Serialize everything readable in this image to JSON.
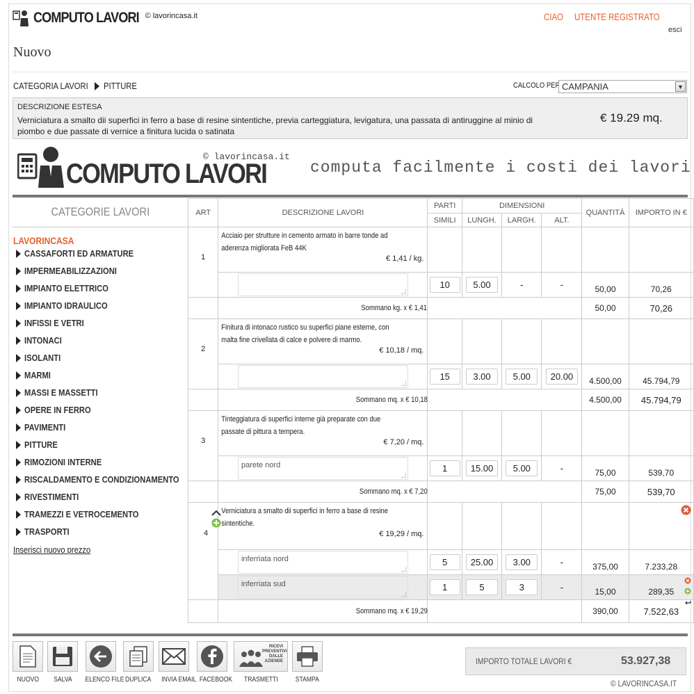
{
  "header": {
    "brand": "COMPUTO LAVORI",
    "site": "© lavorincasa.it",
    "greeting": "CIAO",
    "user": "UTENTE REGISTRATO",
    "logout": "esci"
  },
  "page_title": "Nuovo",
  "breadcrumb": {
    "root": "CATEGORIA LAVORI",
    "current": "PITTURE"
  },
  "calc": {
    "label": "CALCOLO PER",
    "region": "CAMPANIA"
  },
  "description": {
    "heading": "DESCRIZIONE ESTESA",
    "text": "Verniciatura a smalto dii superfici in ferro a base di resine sintentiche, previa carteggiatura, levigatura, una passata di antiruggine al minio di piombo e due passate di vernice a finitura lucida o satinata",
    "price": "€ 19.29 mq."
  },
  "banner": {
    "brand": "COMPUTO LAVORI",
    "site": "© lavorincasa.it",
    "tagline": "computa facilmente i costi dei lavori"
  },
  "sidebar": {
    "title": "CATEGORIE LAVORI",
    "root": "LAVORINCASA",
    "items": [
      "CASSAFORTI ED ARMATURE",
      "IMPERMEABILIZZAZIONI",
      "IMPIANTO ELETTRICO",
      "IMPIANTO IDRAULICO",
      "INFISSI E VETRI",
      "INTONACI",
      "ISOLANTI",
      "MARMI",
      "MASSI E MASSETTI",
      "OPERE IN FERRO",
      "PAVIMENTI",
      "PITTURE",
      "RIMOZIONI INTERNE",
      "RISCALDAMENTO E CONDIZIONAMENTO",
      "RIVESTIMENTI",
      "TRAMEZZI E VETROCEMENTO",
      "TRASPORTI"
    ],
    "new_price_link": "Inserisci nuovo prezzo"
  },
  "table": {
    "headers": {
      "art": "ART",
      "desc": "DESCRIZIONE LAVORI",
      "parti": "PARTI",
      "simili": "SIMILI",
      "dimensioni": "DIMENSIONI",
      "lungh": "LUNGH.",
      "largh": "LARGH.",
      "alt": "ALT.",
      "quantita": "QUANTITÀ",
      "importo": "IMPORTO IN €"
    },
    "items": [
      {
        "art": "1",
        "desc": "Acciaio per strutture in cemento armato in barre tonde ad aderenza migliorata FeB 44K",
        "price": "€ 1,41 / kg.",
        "rows": [
          {
            "note": "",
            "parti": "10",
            "lungh": "5.00",
            "largh": "-",
            "alt": "-",
            "qty": "50,00",
            "amount": "70,26"
          }
        ],
        "sum_label": "Sommano kg. x € 1,41",
        "sum_qty": "50,00",
        "sum_amount": "70,26"
      },
      {
        "art": "2",
        "desc": "Finitura di intonaco rustico su superfici piane esterne, con malta fine crivellata di calce e polvere di marmo.",
        "price": "€ 10,18 / mq.",
        "rows": [
          {
            "note": "",
            "parti": "15",
            "lungh": "3.00",
            "largh": "5.00",
            "alt": "20.00",
            "qty": "4.500,00",
            "amount": "45.794,79"
          }
        ],
        "sum_label": "Sommano mq. x € 10,18",
        "sum_qty": "4.500,00",
        "sum_amount": "45.794,79"
      },
      {
        "art": "3",
        "desc": "Tinteggiatura di superfici interne già preparate con due passate di pittura a tempera.",
        "price": "€ 7,20 / mq.",
        "rows": [
          {
            "note": "parete nord",
            "parti": "1",
            "lungh": "15.00",
            "largh": "5.00",
            "alt": "-",
            "qty": "75,00",
            "amount": "539,70"
          }
        ],
        "sum_label": "Sommano mq. x € 7,20",
        "sum_qty": "75,00",
        "sum_amount": "539,70"
      },
      {
        "art": "4",
        "desc": "Verniciatura a smalto dii superfici in ferro a base di resine sintentiche.",
        "price": "€ 19,29 / mq.",
        "rows": [
          {
            "note": "inferriata nord",
            "parti": "5",
            "lungh": "25.00",
            "largh": "3.00",
            "alt": "-",
            "qty": "375,00",
            "amount": "7.233,28"
          },
          {
            "note": "inferriata sud",
            "parti": "1",
            "lungh": "5",
            "largh": "3",
            "alt": "-",
            "qty": "15,00",
            "amount": "289,35"
          }
        ],
        "sum_label": "Sommano mq. x € 19,29",
        "sum_qty": "390,00",
        "sum_amount": "7.522,63"
      }
    ]
  },
  "toolbar": [
    {
      "label": "NUOVO",
      "icon": "document-icon"
    },
    {
      "label": "SALVA",
      "icon": "floppy-icon"
    },
    {
      "label": "ELENCO FILE",
      "icon": "back-arrow-icon"
    },
    {
      "label": "DUPLICA",
      "icon": "duplicate-icon"
    },
    {
      "label": "INVIA EMAIL",
      "icon": "envelope-icon"
    },
    {
      "label": "FACEBOOK",
      "icon": "facebook-icon"
    },
    {
      "label": "TRASMETTI",
      "icon": "people-icon",
      "icon_text": "RICEVI PREVENTIVI DALLE AZIENDE"
    },
    {
      "label": "STAMPA",
      "icon": "printer-icon"
    }
  ],
  "total": {
    "label": "IMPORTO TOTALE LAVORI €",
    "value": "53.927,38"
  },
  "footer": {
    "copyright": "© LAVORINCASA.IT"
  },
  "colors": {
    "accent": "#e8602c",
    "rule": "#777777",
    "panel": "#efefef"
  }
}
